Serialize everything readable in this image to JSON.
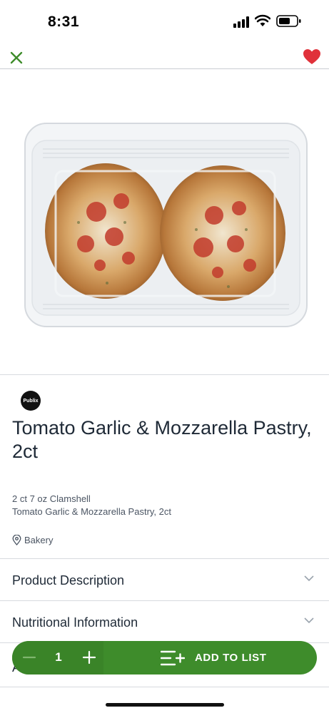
{
  "status_bar": {
    "time": "8:31"
  },
  "header": {
    "close_icon": "close-icon",
    "favorite_icon": "heart-icon",
    "favorite_color": "#e0313a",
    "accent_color": "#3e8c2b"
  },
  "product": {
    "brand_logo_text": "Publix",
    "title": "Tomato Garlic & Mozzarella Pastry, 2ct",
    "size": "2 ct 7 oz Clamshell",
    "subtitle": "Tomato Garlic & Mozzarella Pastry, 2ct",
    "department": "Bakery",
    "department_icon": "location-pin-icon"
  },
  "sections": [
    {
      "label": "Product Description",
      "icon": "chevron-down-icon"
    },
    {
      "label": "Nutritional Information",
      "icon": "chevron-down-icon"
    },
    {
      "label": "A",
      "icon": "chevron-down-icon"
    }
  ],
  "cart": {
    "quantity": "1",
    "minus_icon": "minus-icon",
    "plus_icon": "plus-icon",
    "add_icon": "add-to-list-icon",
    "add_label": "ADD TO LIST",
    "button_color": "#3e8c2b"
  }
}
